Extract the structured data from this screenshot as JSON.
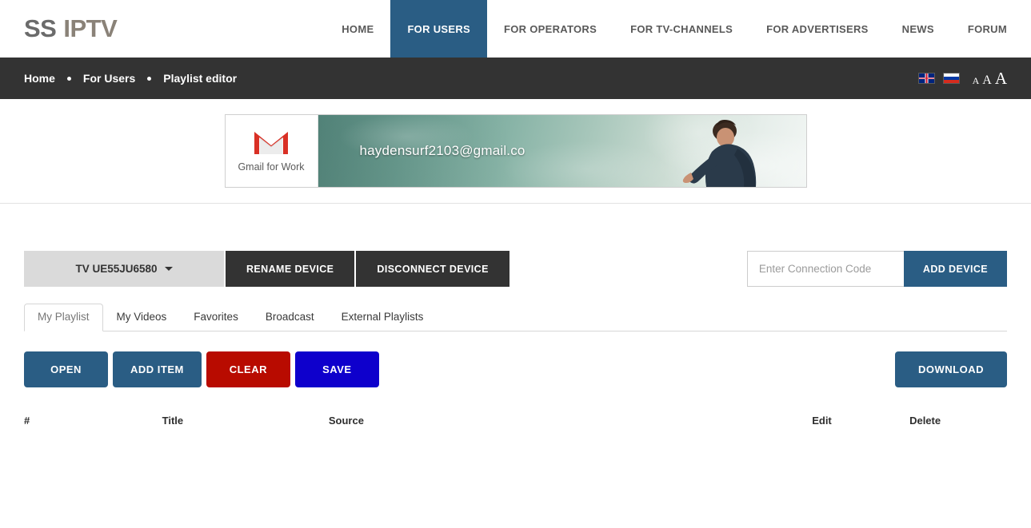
{
  "header": {
    "logo_ss": "SS",
    "logo_iptv": "IPTV",
    "nav": [
      {
        "label": "HOME",
        "active": false
      },
      {
        "label": "FOR USERS",
        "active": true
      },
      {
        "label": "FOR OPERATORS",
        "active": false
      },
      {
        "label": "FOR TV-CHANNELS",
        "active": false
      },
      {
        "label": "FOR ADVERTISERS",
        "active": false
      },
      {
        "label": "NEWS",
        "active": false
      },
      {
        "label": "FORUM",
        "active": false
      }
    ],
    "accent_color": "#2a5d84"
  },
  "breadcrumb": {
    "items": [
      {
        "label": "Home"
      },
      {
        "label": "For Users"
      },
      {
        "label": "Playlist editor"
      }
    ],
    "languages": [
      {
        "name": "english-flag",
        "code": "EN"
      },
      {
        "name": "russian-flag",
        "code": "RU"
      }
    ],
    "font_sizes": [
      {
        "label": "A",
        "size": "small"
      },
      {
        "label": "A",
        "size": "medium"
      },
      {
        "label": "A",
        "size": "large"
      }
    ],
    "bar_color": "#333333"
  },
  "banner": {
    "brand_label": "Gmail for Work",
    "email_text": "haydensurf2103@gmail.co",
    "logo_icon": "gmail-envelope-icon"
  },
  "device": {
    "selected": "TV UE55JU6580",
    "rename_label": "RENAME DEVICE",
    "disconnect_label": "DISCONNECT DEVICE",
    "code_placeholder": "Enter Connection Code",
    "code_value": "",
    "add_device_label": "ADD DEVICE"
  },
  "tabs": [
    {
      "label": "My Playlist",
      "active": true
    },
    {
      "label": "My Videos",
      "active": false
    },
    {
      "label": "Favorites",
      "active": false
    },
    {
      "label": "Broadcast",
      "active": false
    },
    {
      "label": "External Playlists",
      "active": false
    }
  ],
  "actions": {
    "open": "OPEN",
    "add_item": "ADD ITEM",
    "clear": "CLEAR",
    "save": "SAVE",
    "download": "DOWNLOAD",
    "colors": {
      "open": "#2a5d84",
      "add_item": "#2a5d84",
      "clear": "#b80b00",
      "save": "#0e00cc",
      "download": "#2a5d84"
    }
  },
  "playlist_table": {
    "columns": [
      "#",
      "Title",
      "Source",
      "",
      "Edit",
      "Delete"
    ],
    "rows": []
  }
}
